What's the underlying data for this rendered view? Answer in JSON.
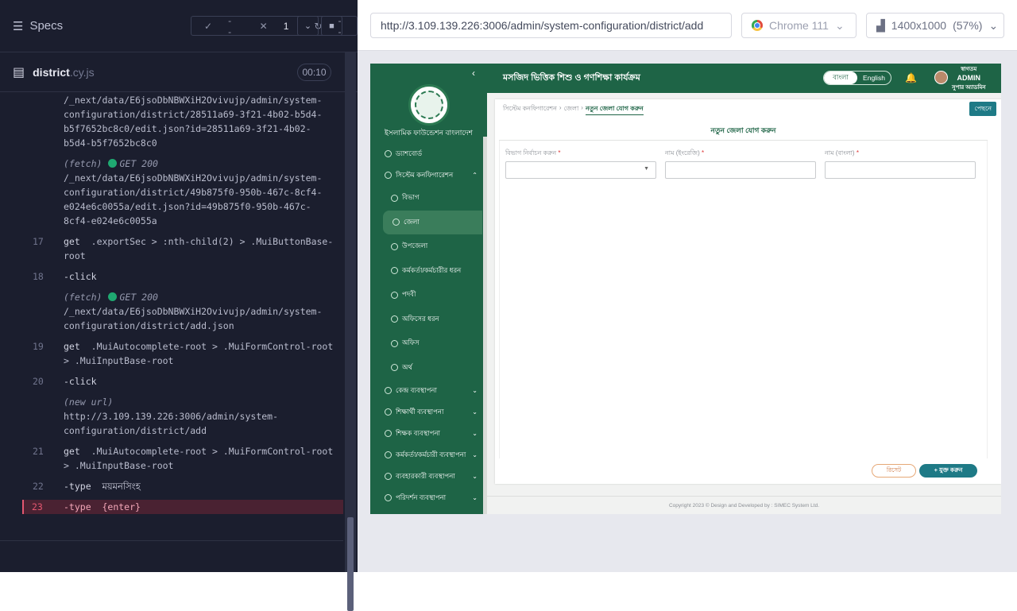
{
  "runner": {
    "panel_title": "Specs",
    "passed": "--",
    "failed": "1",
    "pending": "--",
    "file_name": "district",
    "file_ext": ".cy.js",
    "timer": "00:10"
  },
  "log": [
    {
      "num": "",
      "kind": "url",
      "text": "/_next/data/E6jsoDbNBWXiH2Ovivujp/admin/system-configuration/district/28511a69-3f21-4b02-b5d4-b5f7652bc8c0/edit.json?id=28511a69-3f21-4b02-b5d4-b5f7652bc8c0"
    },
    {
      "num": "",
      "kind": "fetch",
      "label": "(fetch)",
      "status": "GET 200",
      "text": "/_next/data/E6jsoDbNBWXiH2Ovivujp/admin/system-configuration/district/49b875f0-950b-467c-8cf4-e024e6c0055a/edit.json?id=49b875f0-950b-467c-8cf4-e024e6c0055a"
    },
    {
      "num": "17",
      "kind": "cmd",
      "cmd": "get",
      "text": ".exportSec > :nth-child(2) > .MuiButtonBase-root"
    },
    {
      "num": "18",
      "kind": "cmd",
      "cmd": "-click",
      "text": ""
    },
    {
      "num": "",
      "kind": "fetch",
      "label": "(fetch)",
      "status": "GET 200",
      "text": "/_next/data/E6jsoDbNBWXiH2Ovivujp/admin/system-configuration/district/add.json"
    },
    {
      "num": "19",
      "kind": "cmd",
      "cmd": "get",
      "text": ".MuiAutocomplete-root > .MuiFormControl-root > .MuiInputBase-root"
    },
    {
      "num": "20",
      "kind": "cmd",
      "cmd": "-click",
      "text": ""
    },
    {
      "num": "",
      "kind": "newurl",
      "label": "(new url)",
      "text": "http://3.109.139.226:3006/admin/system-configuration/district/add"
    },
    {
      "num": "21",
      "kind": "cmd",
      "cmd": "get",
      "text": ".MuiAutocomplete-root > .MuiFormControl-root > .MuiInputBase-root"
    },
    {
      "num": "22",
      "kind": "cmd",
      "cmd": "-type",
      "text": "ময়মনসিংহ"
    },
    {
      "num": "23",
      "kind": "cmd",
      "cmd": "-type",
      "text": "{enter}",
      "active": true
    }
  ],
  "browser": {
    "url": "http://3.109.139.226:3006/admin/system-configuration/district/add",
    "name": "Chrome 111",
    "viewport": "1400x1000",
    "zoom": "(57%)"
  },
  "app": {
    "org_name": "ইসলামিক ফাউন্ডেশন বাংলাদেশ",
    "header_title": "মসজিদ ভিত্তিক শিশু ও গণশিক্ষা কার্যক্রম",
    "lang_bn": "বাংলা",
    "lang_en": "English",
    "user_greeting": "স্বাগতম",
    "user_name": "ADMIN",
    "user_role": "সুপার অ্যাডমিন",
    "menu": [
      {
        "label": "ড্যাশবোর্ড",
        "type": "top"
      },
      {
        "label": "সিস্টেম কনফিগারেশন",
        "type": "top",
        "chev": "⌃"
      },
      {
        "label": "বিভাগ",
        "type": "sub"
      },
      {
        "label": "জেলা",
        "type": "sub",
        "active": true
      },
      {
        "label": "উপজেলা",
        "type": "sub"
      },
      {
        "label": "কর্মকর্তা/কর্মচারীর ধরন",
        "type": "sub"
      },
      {
        "label": "পদবী",
        "type": "sub"
      },
      {
        "label": "অফিসের ধরন",
        "type": "sub"
      },
      {
        "label": "অফিস",
        "type": "sub"
      },
      {
        "label": "অর্থ",
        "type": "sub"
      },
      {
        "label": "কেন্দ্র ব্যবস্থাপনা",
        "type": "top",
        "chev": "⌄"
      },
      {
        "label": "শিক্ষার্থী ব্যবস্থাপনা",
        "type": "top",
        "chev": "⌄"
      },
      {
        "label": "শিক্ষক ব্যবস্থাপনা",
        "type": "top",
        "chev": "⌄"
      },
      {
        "label": "কর্মকর্তা/কর্মচারী ব্যবস্থাপনা",
        "type": "top",
        "chev": "⌄"
      },
      {
        "label": "ব্যবহারকারী ব্যবস্থাপনা",
        "type": "top",
        "chev": "⌄"
      },
      {
        "label": "পরিদর্শন ব্যবস্থাপনা",
        "type": "top",
        "chev": "⌄"
      }
    ],
    "breadcrumb": [
      "সিস্টেম কনফিগারেশন",
      "জেলা",
      "নতুন জেলা যোগ করুন"
    ],
    "back_label": "পেছনে",
    "form_title": "নতুন জেলা যোগ করুন",
    "fields": [
      {
        "label": "বিভাগ নির্বাচন করুন",
        "type": "select"
      },
      {
        "label": "নাম (ইংরেজি)",
        "type": "text"
      },
      {
        "label": "নাম (বাংলা)",
        "type": "text"
      }
    ],
    "reset_label": "রিসেট",
    "add_label": "+ যুক্ত করুন",
    "footer": "Copyright 2023 © Design and Developed by : SIMEC System Ltd."
  }
}
